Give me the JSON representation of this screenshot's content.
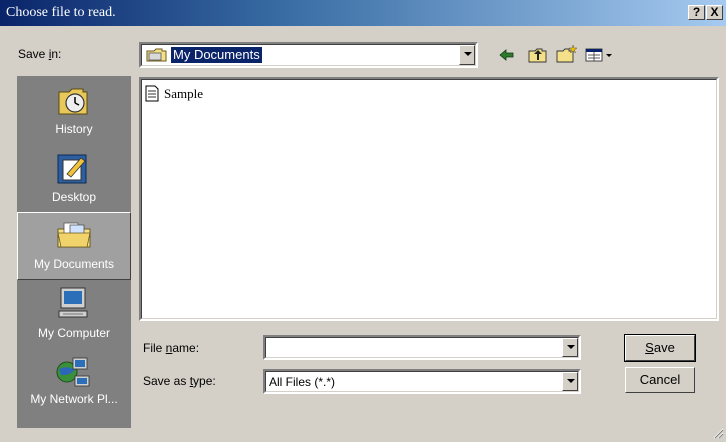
{
  "window": {
    "title": "Choose file to read."
  },
  "title_buttons": {
    "help": "?",
    "close": "X"
  },
  "lookin": {
    "label_prefix": "Save ",
    "label_accel": "i",
    "label_suffix": "n:",
    "value": "My Documents"
  },
  "toolbar": {
    "icons": [
      "back-arrow-icon",
      "up-folder-icon",
      "new-folder-icon",
      "view-menu-icon"
    ]
  },
  "places": [
    {
      "label": "History",
      "icon": "history-icon"
    },
    {
      "label": "Desktop",
      "icon": "desktop-icon"
    },
    {
      "label": "My Documents",
      "icon": "my-documents-icon",
      "selected": true
    },
    {
      "label": "My Computer",
      "icon": "my-computer-icon"
    },
    {
      "label": "My Network Pl...",
      "icon": "network-places-icon"
    }
  ],
  "files": [
    {
      "name": "Sample",
      "icon": "text-file-icon"
    }
  ],
  "filename": {
    "label_prefix": "File ",
    "label_accel": "n",
    "label_suffix": "ame:",
    "value": ""
  },
  "filetype": {
    "label_prefix": "Save as ",
    "label_accel": "t",
    "label_suffix": "ype:",
    "value": "All Files (*.*)"
  },
  "buttons": {
    "save_accel": "S",
    "save_rest": "ave",
    "cancel": "Cancel"
  },
  "colors": {
    "title_start": "#0a246a",
    "title_end": "#a6caf0",
    "face": "#d4d0c8",
    "places_bg": "#808080",
    "selection": "#0a246a"
  }
}
